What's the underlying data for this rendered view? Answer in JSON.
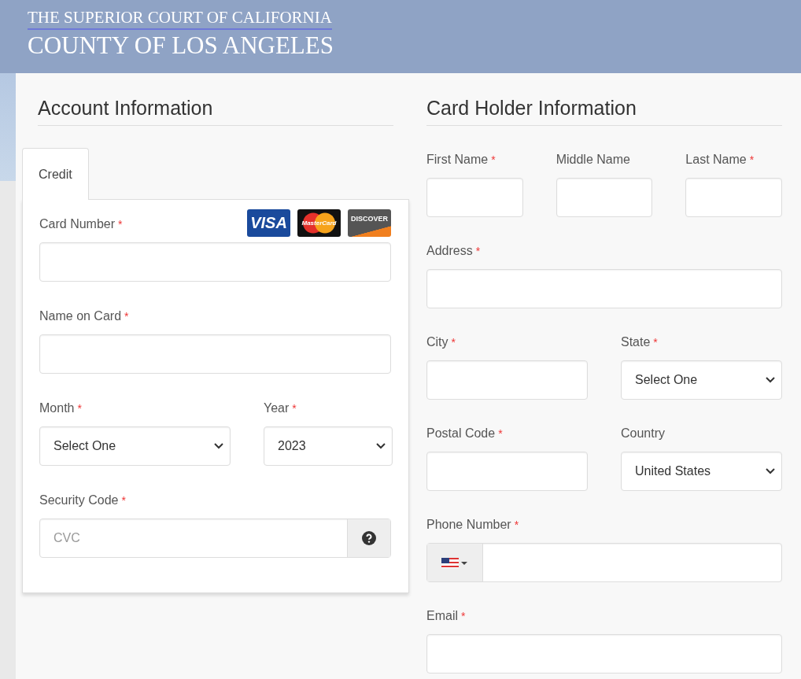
{
  "header": {
    "line1": "THE SUPERIOR COURT OF CALIFORNIA",
    "line2": "COUNTY OF LOS ANGELES"
  },
  "account": {
    "title": "Account Information",
    "tabs": [
      {
        "label": "Credit",
        "selected": true
      }
    ],
    "card_logos": [
      {
        "kind": "visa",
        "text": "VISA"
      },
      {
        "kind": "mastercard",
        "text": "MasterCard"
      },
      {
        "kind": "discover",
        "text": "DISCOVER"
      }
    ],
    "rows": [
      [
        {
          "kind": "text",
          "label": "Card Number",
          "required_mark": "*",
          "logos": true
        }
      ],
      [
        {
          "kind": "text",
          "label": "Name on Card",
          "required_mark": "*"
        }
      ],
      [
        {
          "kind": "select",
          "label": "Month",
          "required_mark": "*",
          "value": "Select One"
        },
        {
          "kind": "select",
          "label": "Year",
          "required_mark": "*",
          "value": "2023"
        }
      ],
      [
        {
          "kind": "help",
          "label": "Security Code",
          "required_mark": "*",
          "placeholder": "CVC"
        }
      ]
    ]
  },
  "holder": {
    "title": "Card Holder Information",
    "rows": [
      [
        {
          "kind": "text",
          "label": "First Name",
          "required_mark": "*"
        },
        {
          "kind": "text",
          "label": "Middle Name"
        },
        {
          "kind": "text",
          "label": "Last Name",
          "required_mark": "*"
        }
      ],
      [
        {
          "kind": "text",
          "label": "Address",
          "required_mark": "*"
        }
      ],
      [
        {
          "kind": "text",
          "label": "City",
          "required_mark": "*"
        },
        {
          "kind": "select",
          "label": "State",
          "required_mark": "*",
          "value": "Select One"
        }
      ],
      [
        {
          "kind": "text",
          "label": "Postal Code",
          "required_mark": "*"
        },
        {
          "kind": "select",
          "label": "Country",
          "value": "United States"
        }
      ],
      [
        {
          "kind": "phone",
          "label": "Phone Number",
          "required_mark": "*"
        }
      ],
      [
        {
          "kind": "text",
          "label": "Email",
          "required_mark": "*"
        }
      ]
    ]
  }
}
